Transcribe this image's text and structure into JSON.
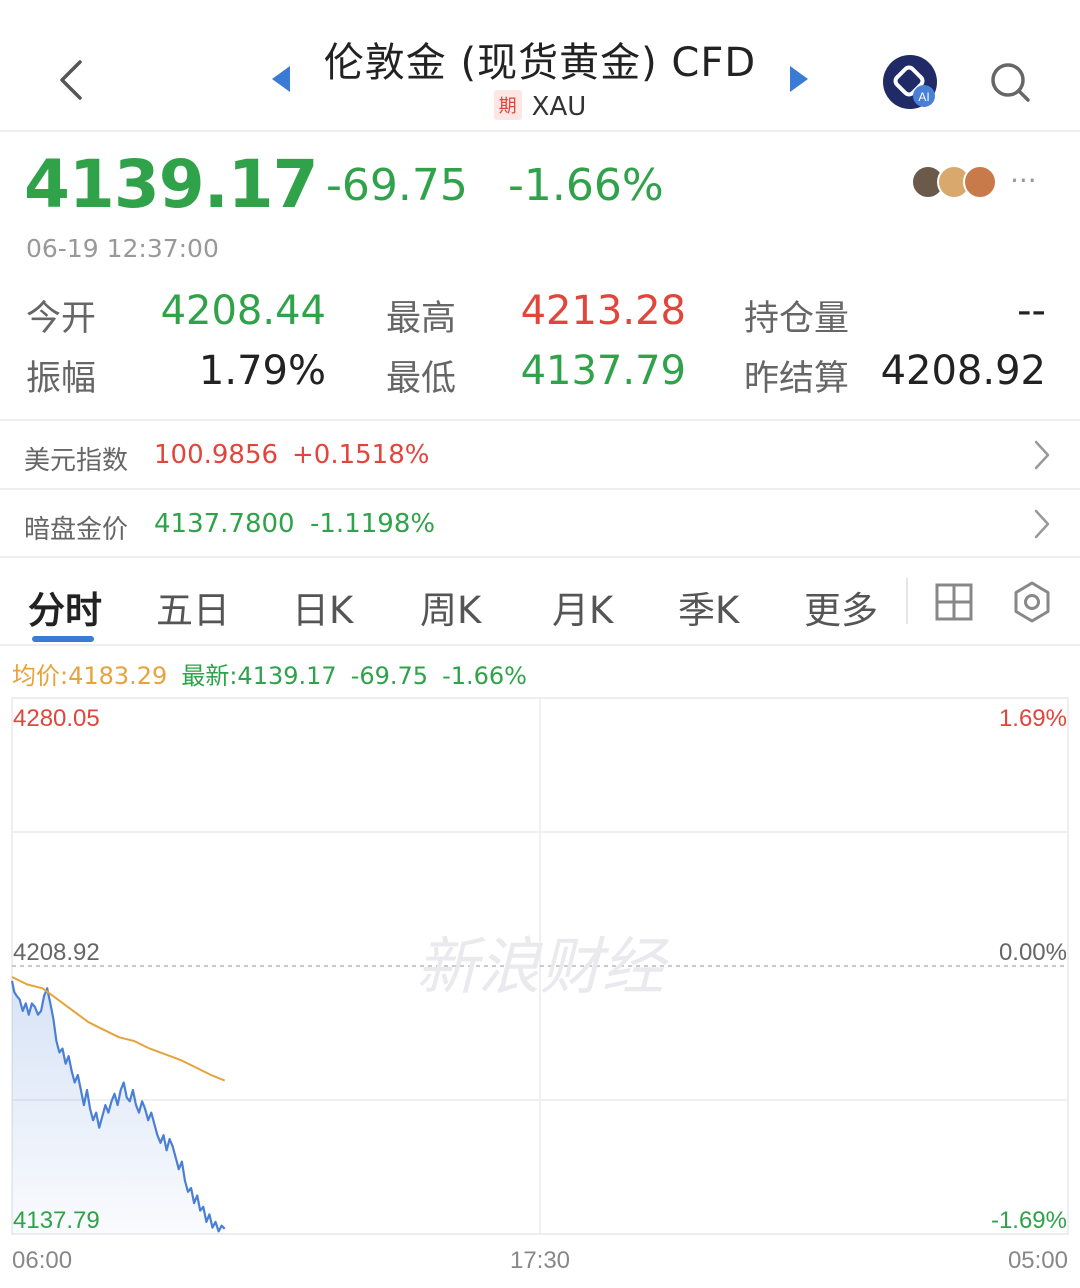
{
  "header": {
    "title": "伦敦金 (现货黄金) CFD",
    "badge": "期",
    "code": "XAU"
  },
  "quote": {
    "price": "4139.17",
    "change": "-69.75",
    "change_pct": "-1.66%",
    "time": "06-19 12:37:00",
    "more": "···"
  },
  "stats": {
    "open_label": "今开",
    "open": "4208.44",
    "high_label": "最高",
    "high": "4213.28",
    "oi_label": "持仓量",
    "oi": "--",
    "amp_label": "振幅",
    "amp": "1.79%",
    "low_label": "最低",
    "low": "4137.79",
    "prev_label": "昨结算",
    "prev": "4208.92"
  },
  "usd_index": {
    "label": "美元指数",
    "value": "100.9856",
    "change": "+0.1518%"
  },
  "dark_gold": {
    "label": "暗盘金价",
    "value": "4137.7800",
    "change": "-1.1198%"
  },
  "tabs": [
    "分时",
    "五日",
    "日K",
    "周K",
    "月K",
    "季K",
    "更多"
  ],
  "legend": {
    "avg": "均价:4183.29",
    "latest": "最新:4139.17",
    "change": "-69.75",
    "pct": "-1.66%"
  },
  "colors": {
    "up": "#e0463c",
    "down": "#2fa24a",
    "line": "#4a7fd6",
    "avg": "#e6a33b"
  },
  "chart_data": {
    "type": "line",
    "y_left_ticks": [
      "4280.05",
      "4208.92",
      "4137.79"
    ],
    "y_right_ticks": [
      "1.69%",
      "0.00%",
      "-1.69%"
    ],
    "x_ticks": [
      "06:00",
      "17:30",
      "05:00"
    ],
    "watermark": "新浪财经",
    "ylim": [
      4137.79,
      4280.05
    ],
    "baseline": 4208.92,
    "total_minutes": 1380,
    "series": [
      {
        "points": [
          [
            0,
            4205
          ],
          [
            3,
            4202
          ],
          [
            6,
            4201
          ],
          [
            10,
            4200
          ],
          [
            14,
            4197
          ],
          [
            18,
            4199
          ],
          [
            22,
            4196
          ],
          [
            26,
            4199
          ],
          [
            30,
            4198
          ],
          [
            34,
            4196
          ],
          [
            38,
            4197
          ],
          [
            42,
            4201
          ],
          [
            46,
            4203
          ],
          [
            50,
            4199
          ],
          [
            54,
            4195
          ],
          [
            58,
            4189
          ],
          [
            62,
            4186
          ],
          [
            66,
            4187
          ],
          [
            70,
            4183
          ],
          [
            74,
            4185
          ],
          [
            78,
            4181
          ],
          [
            82,
            4178
          ],
          [
            86,
            4180
          ],
          [
            90,
            4176
          ],
          [
            94,
            4172
          ],
          [
            98,
            4176
          ],
          [
            102,
            4171
          ],
          [
            106,
            4168
          ],
          [
            110,
            4170
          ],
          [
            114,
            4166
          ],
          [
            118,
            4169
          ],
          [
            122,
            4172
          ],
          [
            126,
            4170
          ],
          [
            130,
            4173
          ],
          [
            134,
            4175
          ],
          [
            138,
            4172
          ],
          [
            142,
            4176
          ],
          [
            146,
            4178
          ],
          [
            150,
            4174
          ],
          [
            154,
            4173
          ],
          [
            158,
            4176
          ],
          [
            162,
            4172
          ],
          [
            166,
            4170
          ],
          [
            170,
            4173
          ],
          [
            174,
            4171
          ],
          [
            178,
            4168
          ],
          [
            182,
            4170
          ],
          [
            186,
            4167
          ],
          [
            190,
            4164
          ],
          [
            194,
            4162
          ],
          [
            198,
            4164
          ],
          [
            202,
            4160
          ],
          [
            206,
            4163
          ],
          [
            210,
            4161
          ],
          [
            214,
            4158
          ],
          [
            218,
            4155
          ],
          [
            222,
            4157
          ],
          [
            226,
            4152
          ],
          [
            230,
            4149
          ],
          [
            234,
            4150
          ],
          [
            238,
            4146
          ],
          [
            242,
            4148
          ],
          [
            246,
            4144
          ],
          [
            250,
            4145
          ],
          [
            254,
            4141
          ],
          [
            258,
            4143
          ],
          [
            262,
            4139.5
          ],
          [
            266,
            4141
          ],
          [
            270,
            4138.5
          ],
          [
            274,
            4140
          ],
          [
            278,
            4139.17
          ]
        ]
      },
      {
        "points": [
          [
            0,
            4206
          ],
          [
            20,
            4204
          ],
          [
            40,
            4203
          ],
          [
            60,
            4200
          ],
          [
            80,
            4197
          ],
          [
            100,
            4194
          ],
          [
            120,
            4192
          ],
          [
            140,
            4190
          ],
          [
            160,
            4189
          ],
          [
            180,
            4187
          ],
          [
            200,
            4185.5
          ],
          [
            220,
            4184
          ],
          [
            240,
            4182
          ],
          [
            260,
            4180
          ],
          [
            278,
            4178.5
          ]
        ]
      }
    ]
  }
}
